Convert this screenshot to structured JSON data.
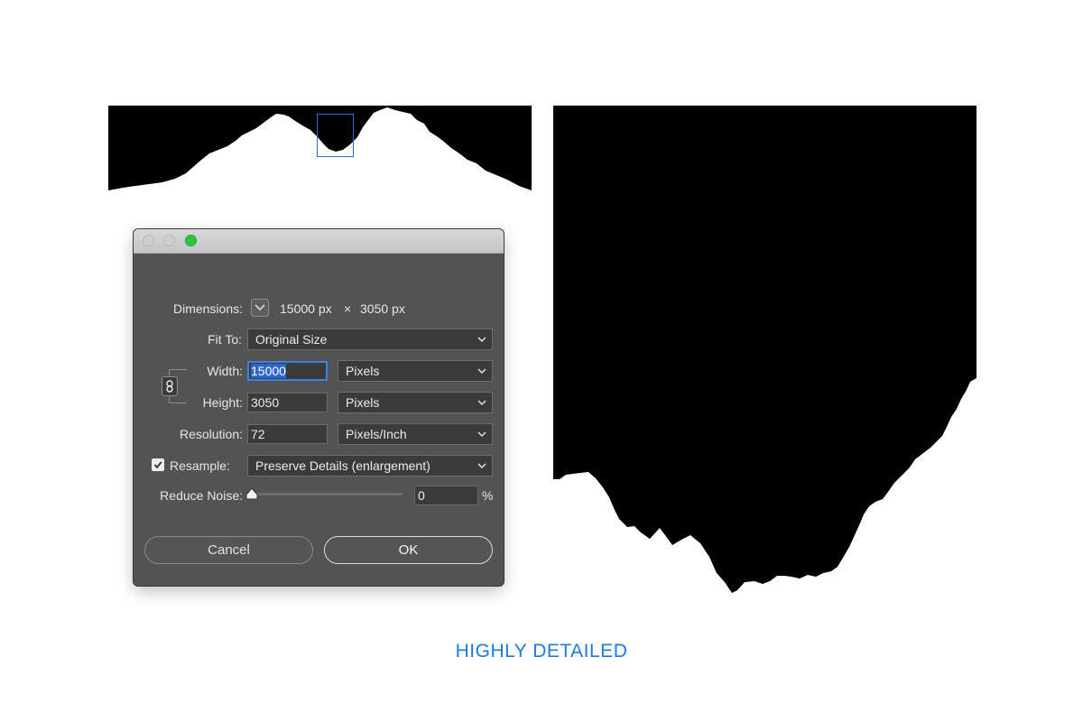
{
  "dialog": {
    "dimensions_label": "Dimensions:",
    "dimensions_width": "15000 px",
    "dimensions_x": "×",
    "dimensions_height": "3050 px",
    "fit_to_label": "Fit To:",
    "fit_to_value": "Original Size",
    "width_label": "Width:",
    "width_value": "15000",
    "width_unit": "Pixels",
    "height_label": "Height:",
    "height_value": "3050",
    "height_unit": "Pixels",
    "resolution_label": "Resolution:",
    "resolution_value": "72",
    "resolution_unit": "Pixels/Inch",
    "resample_label": "Resample:",
    "resample_checked": true,
    "resample_value": "Preserve Details (enlargement)",
    "reduce_noise_label": "Reduce Noise:",
    "reduce_noise_value": "0",
    "reduce_noise_unit": "%",
    "reduce_noise_level": 0,
    "cancel_label": "Cancel",
    "ok_label": "OK"
  },
  "caption": "HIGHLY DETAILED",
  "colors": {
    "accent": "#1d7ae0",
    "dialog_bg": "#535353",
    "focus_ring": "#3c82e0",
    "traffic_green": "#2ac840"
  },
  "icons": [
    "chevron-down-icon",
    "chain-link-icon",
    "checkmark-icon",
    "slider-thumb-icon"
  ]
}
